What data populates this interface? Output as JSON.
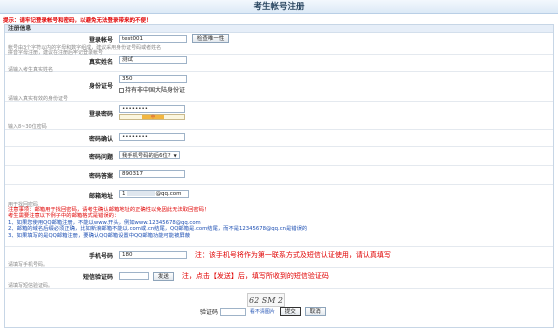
{
  "page_title": "考生帐号注册",
  "warning": "提示：请牢记登录帐号和密码，以避免无法登录带来的不便！",
  "section_title": "注册信息",
  "account": {
    "label": "登录帐号",
    "value": "test001",
    "check_button": "检查唯一性",
    "hint_line1": "帐号由3个字符以内的字母和数字组成，建议采用身份证号码或者姓名",
    "hint_line2": "拼音字母注册，建议在注册后牢记登录帐号"
  },
  "realname": {
    "label": "真实姓名",
    "value": "测试",
    "hint": "请输入考生真实姓名"
  },
  "idcard": {
    "label": "身份证号",
    "value": "350",
    "checkbox_label": "持有非中国大陆身份证",
    "hint": "请输入真实有效的身份证号"
  },
  "password": {
    "label": "登录密码",
    "value": "••••••••",
    "strength_label": "中",
    "hint": "输入8~30位密码"
  },
  "password_confirm": {
    "label": "密码确认",
    "value": "••••••••"
  },
  "question": {
    "label": "密码问题",
    "selected": "我手机号码的后6位?"
  },
  "answer": {
    "label": "密码答案",
    "value": "890317"
  },
  "email": {
    "label": "邮箱地址",
    "value_prefix": "1",
    "value_suffix": "@qq.com",
    "hint": "用于找回密码",
    "notes": [
      "注意事项：邮箱用于找回密码，请考生确认邮箱地址的正确性以免因此无法取回密码！",
      "考生需要注意以下例子中的邮箱格式是错误的：",
      "1、如果您使用QQ邮箱注册，不能以www.开头，例如www.12345678@qq.com",
      "2、邮箱的域名后缀必须正确，比如新浪邮箱不能以.com或.cn结尾，QQ邮箱是.com结尾，而不是12345678@qq.cn是错误的",
      "3、如果填写的是QQ邮箱注册，要确认QQ邮箱设置中QQ邮箱功能可能被屏蔽"
    ]
  },
  "phone": {
    "label": "手机号码",
    "value": "180",
    "note": "注：该手机号将作为第一联系方式及短信认证使用，请认真填写",
    "hint": "请填写手机号码。"
  },
  "sms": {
    "label": "短信验证码",
    "send_button": "发送",
    "note": "注，点击【发送】后，填写所收到的短信验证码",
    "hint": "请填写短信验证码。"
  },
  "footer": {
    "captcha_label": "验证码",
    "captcha_text": "62 SM 2",
    "refresh_link": "看不清图片",
    "submit_button": "提交",
    "cancel_button": "取消"
  }
}
